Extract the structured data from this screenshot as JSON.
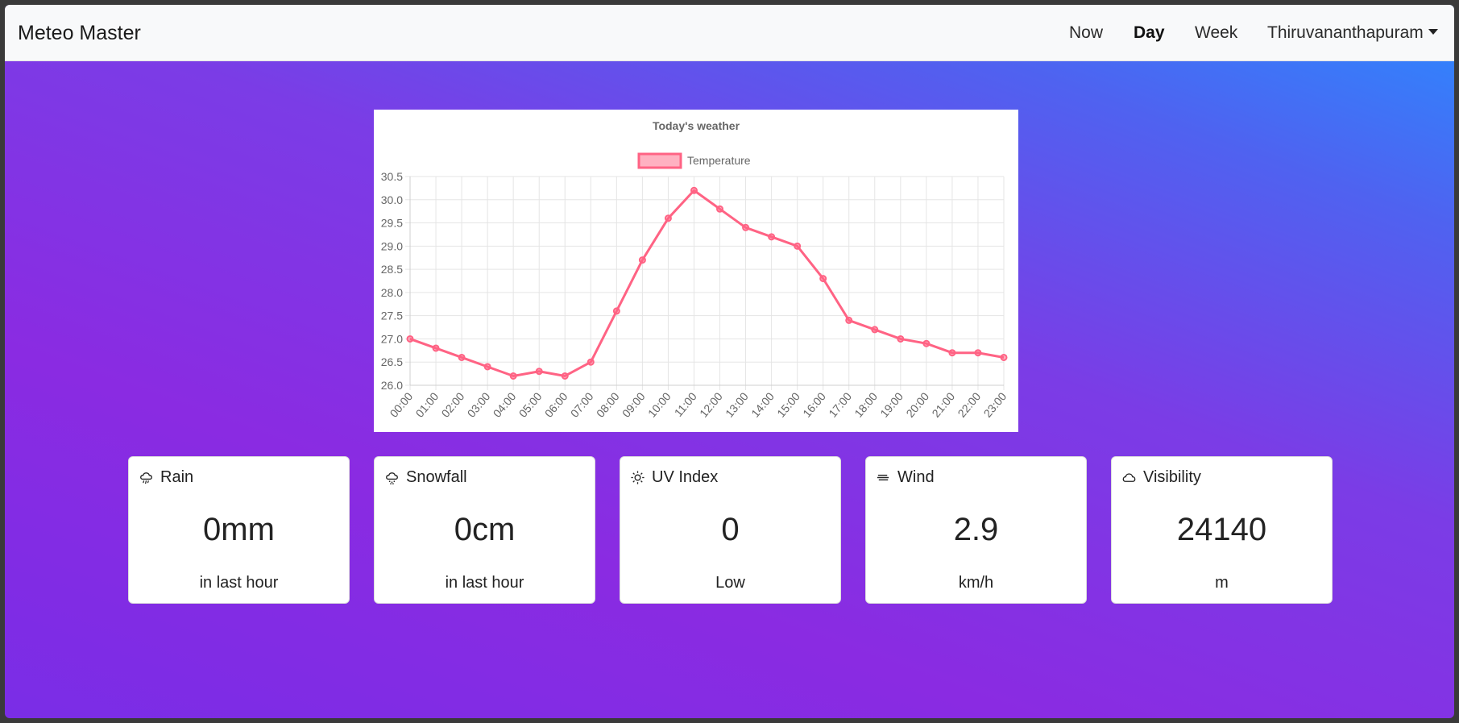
{
  "app": {
    "brand": "Meteo Master"
  },
  "nav": {
    "items": [
      {
        "label": "Now",
        "active": false
      },
      {
        "label": "Day",
        "active": true
      },
      {
        "label": "Week",
        "active": false
      }
    ],
    "location": "Thiruvananthapuram"
  },
  "chart_data": {
    "type": "line",
    "title": "Today's weather",
    "legend": "top",
    "grid": true,
    "x": [
      "00:00",
      "01:00",
      "02:00",
      "03:00",
      "04:00",
      "05:00",
      "06:00",
      "07:00",
      "08:00",
      "09:00",
      "10:00",
      "11:00",
      "12:00",
      "13:00",
      "14:00",
      "15:00",
      "16:00",
      "17:00",
      "18:00",
      "19:00",
      "20:00",
      "21:00",
      "22:00",
      "23:00"
    ],
    "series": [
      {
        "name": "Temperature",
        "color": "#ff6384",
        "values": [
          27.0,
          26.8,
          26.6,
          26.4,
          26.2,
          26.3,
          26.2,
          26.5,
          27.6,
          28.7,
          29.6,
          30.2,
          29.8,
          29.4,
          29.2,
          29.0,
          28.3,
          27.4,
          27.2,
          27.0,
          26.9,
          26.7,
          26.7,
          26.6
        ]
      }
    ],
    "ylim": [
      26.0,
      30.5
    ],
    "yticks": [
      "30.5",
      "30.0",
      "29.5",
      "29.0",
      "28.5",
      "28.0",
      "27.5",
      "27.0",
      "26.5",
      "26.0"
    ]
  },
  "cards": [
    {
      "title": "Rain",
      "icon": "rain-cloud-icon",
      "value": "0mm",
      "sub": "in last hour"
    },
    {
      "title": "Snowfall",
      "icon": "snow-cloud-icon",
      "value": "0cm",
      "sub": "in last hour"
    },
    {
      "title": "UV Index",
      "icon": "sun-icon",
      "value": "0",
      "sub": "Low"
    },
    {
      "title": "Wind",
      "icon": "wind-icon",
      "value": "2.9",
      "sub": "km/h"
    },
    {
      "title": "Visibility",
      "icon": "cloud-icon",
      "value": "24140",
      "sub": "m"
    }
  ]
}
